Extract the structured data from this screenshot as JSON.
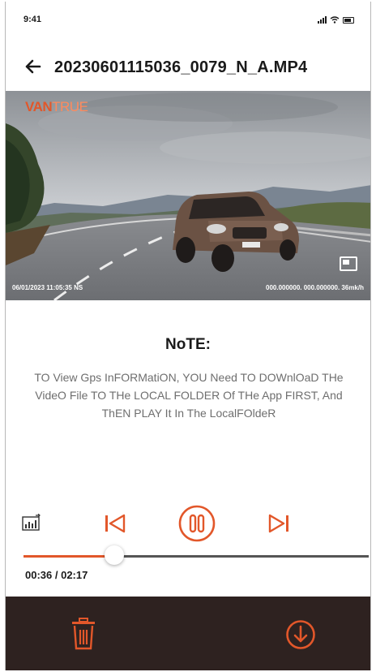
{
  "status_bar": {
    "time": "9:41",
    "icons": [
      "signal-icon",
      "wifi-icon",
      "battery-icon"
    ]
  },
  "header": {
    "back_icon": "arrow-left-icon",
    "title": "20230601115036_0079_N_A.MP4"
  },
  "video": {
    "brand_part1": "VAN",
    "brand_part2": "TRUE",
    "overlay_left": "06/01/2023 11:05:35  NS",
    "overlay_right": "000.000000.  000.000000.  36mk/h",
    "pip_icon": "picture-in-picture-icon"
  },
  "note": {
    "title": "NoTE:",
    "body": "TO View Gps InFORMatiON, YOU Need TO DOWnlOaD THe VideO File TO THe LOCAL FOLDER Of THe App FIRST, And ThEN PLAY It In The LocalFOldeR"
  },
  "controls": {
    "chart_icon": "stats-chart-icon",
    "prev_icon": "skip-previous-icon",
    "pause_icon": "pause-icon",
    "next_icon": "skip-next-icon",
    "current_time": "00:36",
    "total_time": "02:17",
    "time_display": "00:36 / 02:17",
    "progress_fraction": 0.263
  },
  "bottom_bar": {
    "delete_icon": "trash-icon",
    "download_icon": "download-icon"
  },
  "colors": {
    "accent": "#e2572a",
    "bottom_bar": "#2e2220",
    "text_primary": "#1a1a1a",
    "text_secondary": "#6e6e6e"
  }
}
